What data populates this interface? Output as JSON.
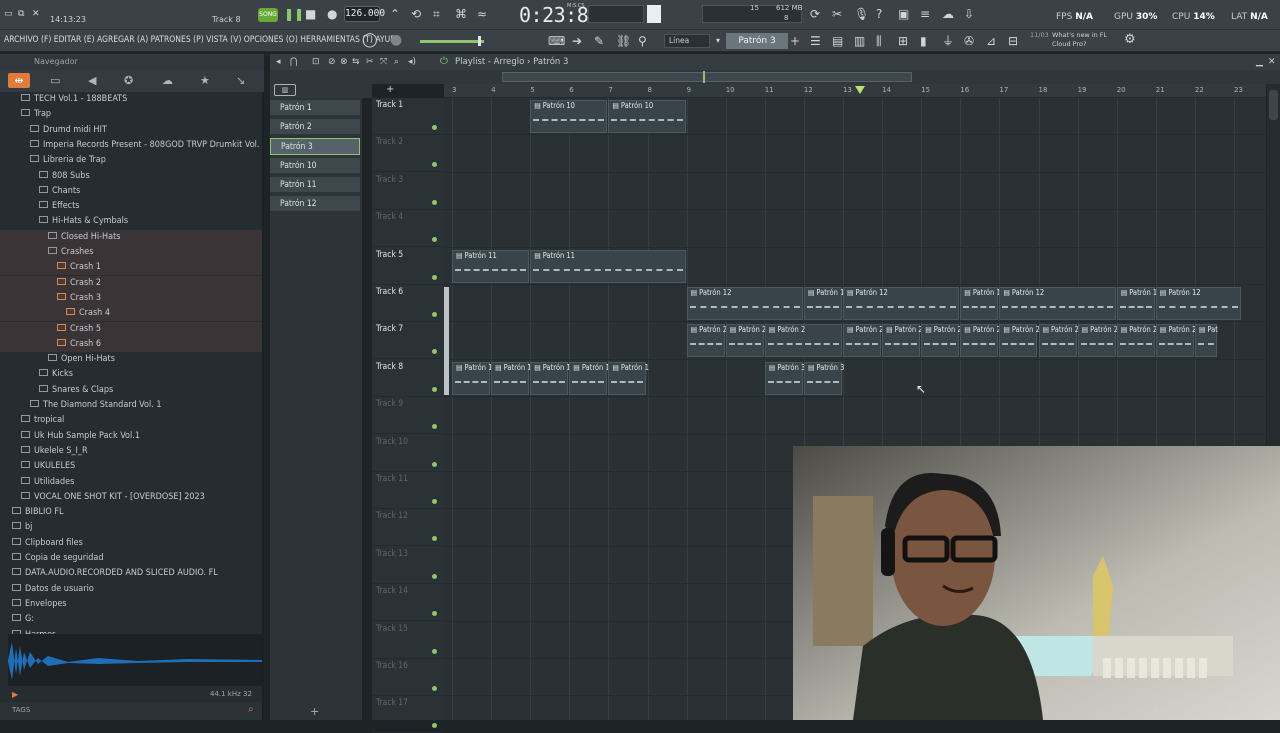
{
  "topbar": {
    "time_left": "14:13:23",
    "track_label": "Track 8",
    "song_mode": "SONG",
    "bpm": "126.000",
    "song_time": "0:23:81",
    "time_unit": "M:S:CS",
    "mem": "612 MB",
    "cpu_small": "15",
    "voices": "8",
    "fps_label": "FPS",
    "fps_value": "N/A",
    "gpu_label": "GPU",
    "gpu_value": "30%",
    "cpu_label": "CPU",
    "cpu_value": "14%",
    "lat_label": "LAT",
    "lat_value": "N/A"
  },
  "menubar": {
    "items": "ARCHIVO (F) EDITAR (E) AGREGAR (A) PATRONES (P) VISTA (V) OPCIONES (O) HERRAMIENTAS (T) AYUDA",
    "snap": "Línea",
    "pattern_selector": "Patrón 3",
    "news_date": "11/03",
    "news_text": "What's new in FL Cloud Pro?"
  },
  "browser": {
    "title": "Navegador",
    "items": [
      {
        "label": "TECH Vol.1 - 188BEATS",
        "indent": 1
      },
      {
        "label": "Trap",
        "indent": 1
      },
      {
        "label": "Drumd midi HIT",
        "indent": 2
      },
      {
        "label": "Imperia Records Present - 808GOD TRVP Drumkit Vol. 1",
        "indent": 2
      },
      {
        "label": "Libreria de Trap",
        "indent": 2
      },
      {
        "label": "808 Subs",
        "indent": 3
      },
      {
        "label": "Chants",
        "indent": 3
      },
      {
        "label": "Effects",
        "indent": 3
      },
      {
        "label": "Hi-Hats & Cymbals",
        "indent": 3
      },
      {
        "label": "Closed Hi-Hats",
        "indent": 4
      },
      {
        "label": "Crashes",
        "indent": 4
      },
      {
        "label": "Crash 1",
        "indent": 5,
        "file": true
      },
      {
        "label": "Crash 2",
        "indent": 5,
        "file": true
      },
      {
        "label": "Crash 3",
        "indent": 5,
        "file": true
      },
      {
        "label": "Crash 4",
        "indent": 6,
        "file": true,
        "selected": true
      },
      {
        "label": "Crash 5",
        "indent": 5,
        "file": true
      },
      {
        "label": "Crash 6",
        "indent": 5,
        "file": true
      },
      {
        "label": "Open Hi-Hats",
        "indent": 4
      },
      {
        "label": "Kicks",
        "indent": 3
      },
      {
        "label": "Snares & Claps",
        "indent": 3
      },
      {
        "label": "The Diamond Standard Vol. 1",
        "indent": 2
      },
      {
        "label": "tropical",
        "indent": 1
      },
      {
        "label": "Uk Hub Sample Pack Vol.1",
        "indent": 1
      },
      {
        "label": "Ukelele S_I_R",
        "indent": 1
      },
      {
        "label": "UKULELES",
        "indent": 1
      },
      {
        "label": "Utilidades",
        "indent": 1
      },
      {
        "label": "VOCAL ONE SHOT KIT - [OVERDOSE] 2023",
        "indent": 1
      },
      {
        "label": "BIBLIO FL",
        "indent": 0
      },
      {
        "label": "bj",
        "indent": 0
      },
      {
        "label": "Clipboard files",
        "indent": 0
      },
      {
        "label": "Copia de seguridad",
        "indent": 0
      },
      {
        "label": "DATA.AUDIO.RECORDED AND SLICED AUDIO. FL",
        "indent": 0
      },
      {
        "label": "Datos de usuario",
        "indent": 0
      },
      {
        "label": "Envelopes",
        "indent": 0
      },
      {
        "label": "G:",
        "indent": 0
      },
      {
        "label": "Harmor",
        "indent": 0
      }
    ],
    "sample_info": "44.1 kHz 32",
    "tags_label": "TAGS"
  },
  "playlist": {
    "title": "Playlist - Arreglo › Patrón 3",
    "patterns": [
      "Patrón 1",
      "Patrón 2",
      "Patrón 3",
      "Patrón 10",
      "Patrón 11",
      "Patrón 12"
    ],
    "active_pattern": "Patrón 3",
    "ruler": [
      "3",
      "4",
      "5",
      "6",
      "7",
      "8",
      "9",
      "10",
      "11",
      "12",
      "13",
      "14",
      "15",
      "16",
      "17",
      "18",
      "19",
      "20",
      "21",
      "22",
      "23"
    ],
    "tracks": [
      "Track 1",
      "Track 2",
      "Track 3",
      "Track 4",
      "Track 5",
      "Track 6",
      "Track 7",
      "Track 8",
      "Track 9",
      "Track 10",
      "Track 11",
      "Track 12",
      "Track 13",
      "Track 14",
      "Track 15",
      "Track 16",
      "Track 17"
    ],
    "clip_names": {
      "p10": "Patrón 10",
      "p11": "Patrón 11",
      "p12": "Patrón 12",
      "p2": "Patrón 2",
      "p1": "Patrón 1",
      "p3": "Patrón 3",
      "p2_short": "Pat"
    }
  },
  "webcam": {
    "watermark": "dde weoploip buisn"
  }
}
